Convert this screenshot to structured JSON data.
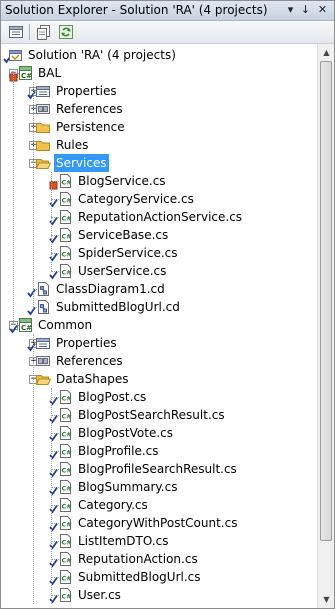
{
  "window": {
    "title": "Solution Explorer - Solution 'RA' (4 projects)",
    "pin_glyph": "↓",
    "close_glyph": "✕",
    "menu_glyph": "▾"
  },
  "toolbar": {
    "buttons": [
      "properties-icon",
      "show-all-files-icon",
      "refresh-icon"
    ]
  },
  "tree": {
    "nodes": [
      {
        "label": "Solution 'RA' (4 projects)",
        "icon": "solution-icon",
        "level": 0,
        "expander": "none",
        "badge": "check"
      },
      {
        "label": "BAL",
        "icon": "csharp-project-icon",
        "level": 1,
        "expander": "minus",
        "badge": "red"
      },
      {
        "label": "Properties",
        "icon": "properties-icon",
        "level": 2,
        "expander": "plus",
        "badge": "check"
      },
      {
        "label": "References",
        "icon": "references-icon",
        "level": 2,
        "expander": "plus",
        "badge": "none"
      },
      {
        "label": "Persistence",
        "icon": "folder-icon",
        "level": 2,
        "expander": "plus",
        "badge": "none"
      },
      {
        "label": "Rules",
        "icon": "folder-icon",
        "level": 2,
        "expander": "plus",
        "badge": "none"
      },
      {
        "label": "Services",
        "icon": "open-folder-icon",
        "level": 2,
        "expander": "minus",
        "badge": "none",
        "selected": true
      },
      {
        "label": "BlogService.cs",
        "icon": "csharp-file-icon",
        "level": 3,
        "expander": "none",
        "badge": "red"
      },
      {
        "label": "CategoryService.cs",
        "icon": "csharp-file-icon",
        "level": 3,
        "expander": "none",
        "badge": "check"
      },
      {
        "label": "ReputationActionService.cs",
        "icon": "csharp-file-icon",
        "level": 3,
        "expander": "none",
        "badge": "check"
      },
      {
        "label": "ServiceBase.cs",
        "icon": "csharp-file-icon",
        "level": 3,
        "expander": "none",
        "badge": "check"
      },
      {
        "label": "SpiderService.cs",
        "icon": "csharp-file-icon",
        "level": 3,
        "expander": "none",
        "badge": "check"
      },
      {
        "label": "UserService.cs",
        "icon": "csharp-file-icon",
        "level": 3,
        "expander": "none",
        "badge": "check"
      },
      {
        "label": "ClassDiagram1.cd",
        "icon": "class-diagram-icon",
        "level": 2,
        "expander": "none",
        "badge": "check"
      },
      {
        "label": "SubmittedBlogUrl.cd",
        "icon": "class-diagram-icon",
        "level": 2,
        "expander": "none",
        "badge": "check"
      },
      {
        "label": "Common",
        "icon": "csharp-project-icon",
        "level": 1,
        "expander": "minus",
        "badge": "check"
      },
      {
        "label": "Properties",
        "icon": "properties-icon",
        "level": 2,
        "expander": "plus",
        "badge": "check"
      },
      {
        "label": "References",
        "icon": "references-icon",
        "level": 2,
        "expander": "plus",
        "badge": "none"
      },
      {
        "label": "DataShapes",
        "icon": "open-folder-icon",
        "level": 2,
        "expander": "minus",
        "badge": "none"
      },
      {
        "label": "BlogPost.cs",
        "icon": "csharp-file-icon",
        "level": 3,
        "expander": "none",
        "badge": "check"
      },
      {
        "label": "BlogPostSearchResult.cs",
        "icon": "csharp-file-icon",
        "level": 3,
        "expander": "none",
        "badge": "check"
      },
      {
        "label": "BlogPostVote.cs",
        "icon": "csharp-file-icon",
        "level": 3,
        "expander": "none",
        "badge": "check"
      },
      {
        "label": "BlogProfile.cs",
        "icon": "csharp-file-icon",
        "level": 3,
        "expander": "none",
        "badge": "check"
      },
      {
        "label": "BlogProfileSearchResult.cs",
        "icon": "csharp-file-icon",
        "level": 3,
        "expander": "none",
        "badge": "check"
      },
      {
        "label": "BlogSummary.cs",
        "icon": "csharp-file-icon",
        "level": 3,
        "expander": "none",
        "badge": "check"
      },
      {
        "label": "Category.cs",
        "icon": "csharp-file-icon",
        "level": 3,
        "expander": "none",
        "badge": "check"
      },
      {
        "label": "CategoryWithPostCount.cs",
        "icon": "csharp-file-icon",
        "level": 3,
        "expander": "none",
        "badge": "check"
      },
      {
        "label": "ListItemDTO.cs",
        "icon": "csharp-file-icon",
        "level": 3,
        "expander": "none",
        "badge": "check"
      },
      {
        "label": "ReputationAction.cs",
        "icon": "csharp-file-icon",
        "level": 3,
        "expander": "none",
        "badge": "check"
      },
      {
        "label": "SubmittedBlogUrl.cs",
        "icon": "csharp-file-icon",
        "level": 3,
        "expander": "none",
        "badge": "check"
      },
      {
        "label": "User.cs",
        "icon": "csharp-file-icon",
        "level": 3,
        "expander": "none",
        "badge": "check"
      }
    ]
  },
  "colors": {
    "selection": "#3399ff",
    "check_badge": "#1f3f9f",
    "red_badge": "#e05020",
    "folder": "#f2c14e",
    "csharp_file": "#2e7d32"
  }
}
